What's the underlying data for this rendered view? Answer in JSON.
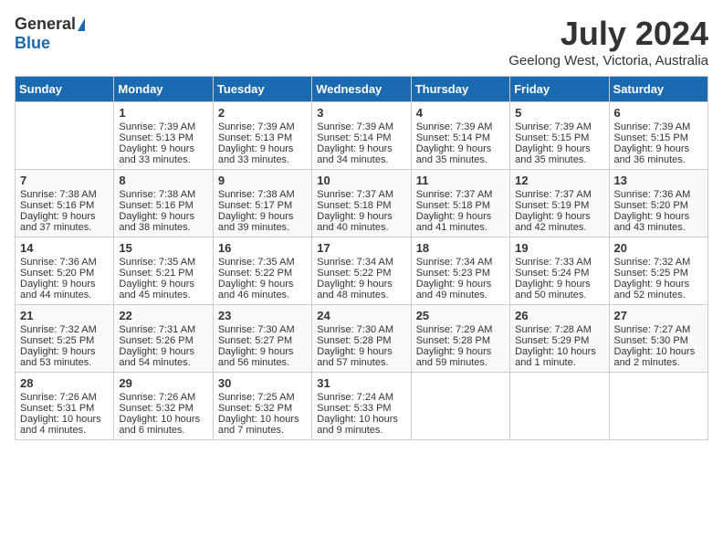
{
  "header": {
    "logo_general": "General",
    "logo_blue": "Blue",
    "month": "July 2024",
    "location": "Geelong West, Victoria, Australia"
  },
  "columns": [
    "Sunday",
    "Monday",
    "Tuesday",
    "Wednesday",
    "Thursday",
    "Friday",
    "Saturday"
  ],
  "weeks": [
    [
      {
        "day": "",
        "lines": []
      },
      {
        "day": "1",
        "lines": [
          "Sunrise: 7:39 AM",
          "Sunset: 5:13 PM",
          "Daylight: 9 hours",
          "and 33 minutes."
        ]
      },
      {
        "day": "2",
        "lines": [
          "Sunrise: 7:39 AM",
          "Sunset: 5:13 PM",
          "Daylight: 9 hours",
          "and 33 minutes."
        ]
      },
      {
        "day": "3",
        "lines": [
          "Sunrise: 7:39 AM",
          "Sunset: 5:14 PM",
          "Daylight: 9 hours",
          "and 34 minutes."
        ]
      },
      {
        "day": "4",
        "lines": [
          "Sunrise: 7:39 AM",
          "Sunset: 5:14 PM",
          "Daylight: 9 hours",
          "and 35 minutes."
        ]
      },
      {
        "day": "5",
        "lines": [
          "Sunrise: 7:39 AM",
          "Sunset: 5:15 PM",
          "Daylight: 9 hours",
          "and 35 minutes."
        ]
      },
      {
        "day": "6",
        "lines": [
          "Sunrise: 7:39 AM",
          "Sunset: 5:15 PM",
          "Daylight: 9 hours",
          "and 36 minutes."
        ]
      }
    ],
    [
      {
        "day": "7",
        "lines": [
          "Sunrise: 7:38 AM",
          "Sunset: 5:16 PM",
          "Daylight: 9 hours",
          "and 37 minutes."
        ]
      },
      {
        "day": "8",
        "lines": [
          "Sunrise: 7:38 AM",
          "Sunset: 5:16 PM",
          "Daylight: 9 hours",
          "and 38 minutes."
        ]
      },
      {
        "day": "9",
        "lines": [
          "Sunrise: 7:38 AM",
          "Sunset: 5:17 PM",
          "Daylight: 9 hours",
          "and 39 minutes."
        ]
      },
      {
        "day": "10",
        "lines": [
          "Sunrise: 7:37 AM",
          "Sunset: 5:18 PM",
          "Daylight: 9 hours",
          "and 40 minutes."
        ]
      },
      {
        "day": "11",
        "lines": [
          "Sunrise: 7:37 AM",
          "Sunset: 5:18 PM",
          "Daylight: 9 hours",
          "and 41 minutes."
        ]
      },
      {
        "day": "12",
        "lines": [
          "Sunrise: 7:37 AM",
          "Sunset: 5:19 PM",
          "Daylight: 9 hours",
          "and 42 minutes."
        ]
      },
      {
        "day": "13",
        "lines": [
          "Sunrise: 7:36 AM",
          "Sunset: 5:20 PM",
          "Daylight: 9 hours",
          "and 43 minutes."
        ]
      }
    ],
    [
      {
        "day": "14",
        "lines": [
          "Sunrise: 7:36 AM",
          "Sunset: 5:20 PM",
          "Daylight: 9 hours",
          "and 44 minutes."
        ]
      },
      {
        "day": "15",
        "lines": [
          "Sunrise: 7:35 AM",
          "Sunset: 5:21 PM",
          "Daylight: 9 hours",
          "and 45 minutes."
        ]
      },
      {
        "day": "16",
        "lines": [
          "Sunrise: 7:35 AM",
          "Sunset: 5:22 PM",
          "Daylight: 9 hours",
          "and 46 minutes."
        ]
      },
      {
        "day": "17",
        "lines": [
          "Sunrise: 7:34 AM",
          "Sunset: 5:22 PM",
          "Daylight: 9 hours",
          "and 48 minutes."
        ]
      },
      {
        "day": "18",
        "lines": [
          "Sunrise: 7:34 AM",
          "Sunset: 5:23 PM",
          "Daylight: 9 hours",
          "and 49 minutes."
        ]
      },
      {
        "day": "19",
        "lines": [
          "Sunrise: 7:33 AM",
          "Sunset: 5:24 PM",
          "Daylight: 9 hours",
          "and 50 minutes."
        ]
      },
      {
        "day": "20",
        "lines": [
          "Sunrise: 7:32 AM",
          "Sunset: 5:25 PM",
          "Daylight: 9 hours",
          "and 52 minutes."
        ]
      }
    ],
    [
      {
        "day": "21",
        "lines": [
          "Sunrise: 7:32 AM",
          "Sunset: 5:25 PM",
          "Daylight: 9 hours",
          "and 53 minutes."
        ]
      },
      {
        "day": "22",
        "lines": [
          "Sunrise: 7:31 AM",
          "Sunset: 5:26 PM",
          "Daylight: 9 hours",
          "and 54 minutes."
        ]
      },
      {
        "day": "23",
        "lines": [
          "Sunrise: 7:30 AM",
          "Sunset: 5:27 PM",
          "Daylight: 9 hours",
          "and 56 minutes."
        ]
      },
      {
        "day": "24",
        "lines": [
          "Sunrise: 7:30 AM",
          "Sunset: 5:28 PM",
          "Daylight: 9 hours",
          "and 57 minutes."
        ]
      },
      {
        "day": "25",
        "lines": [
          "Sunrise: 7:29 AM",
          "Sunset: 5:28 PM",
          "Daylight: 9 hours",
          "and 59 minutes."
        ]
      },
      {
        "day": "26",
        "lines": [
          "Sunrise: 7:28 AM",
          "Sunset: 5:29 PM",
          "Daylight: 10 hours",
          "and 1 minute."
        ]
      },
      {
        "day": "27",
        "lines": [
          "Sunrise: 7:27 AM",
          "Sunset: 5:30 PM",
          "Daylight: 10 hours",
          "and 2 minutes."
        ]
      }
    ],
    [
      {
        "day": "28",
        "lines": [
          "Sunrise: 7:26 AM",
          "Sunset: 5:31 PM",
          "Daylight: 10 hours",
          "and 4 minutes."
        ]
      },
      {
        "day": "29",
        "lines": [
          "Sunrise: 7:26 AM",
          "Sunset: 5:32 PM",
          "Daylight: 10 hours",
          "and 6 minutes."
        ]
      },
      {
        "day": "30",
        "lines": [
          "Sunrise: 7:25 AM",
          "Sunset: 5:32 PM",
          "Daylight: 10 hours",
          "and 7 minutes."
        ]
      },
      {
        "day": "31",
        "lines": [
          "Sunrise: 7:24 AM",
          "Sunset: 5:33 PM",
          "Daylight: 10 hours",
          "and 9 minutes."
        ]
      },
      {
        "day": "",
        "lines": []
      },
      {
        "day": "",
        "lines": []
      },
      {
        "day": "",
        "lines": []
      }
    ]
  ]
}
